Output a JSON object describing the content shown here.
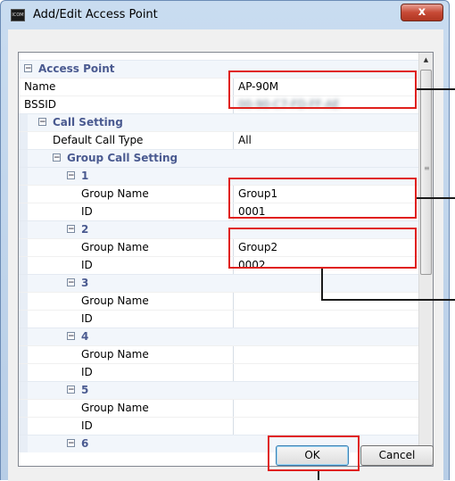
{
  "window": {
    "title": "Add/Edit Access Point",
    "icon_text": "ICOM",
    "close_glyph": "x"
  },
  "grid": {
    "access_point": {
      "label": "Access Point",
      "expander": "−"
    },
    "name": {
      "label": "Name",
      "value": "AP-90M"
    },
    "bssid": {
      "label": "BSSID",
      "value": "00-90-C7-FD-FF-AE"
    },
    "call_setting": {
      "label": "Call Setting",
      "expander": "−"
    },
    "default_call_type": {
      "label": "Default Call Type",
      "value": "All"
    },
    "group_call_setting": {
      "label": "Group Call Setting",
      "expander": "−"
    },
    "groups": [
      {
        "index": "1",
        "expander": "−",
        "name_label": "Group Name",
        "name_value": "Group1",
        "id_label": "ID",
        "id_value": "0001"
      },
      {
        "index": "2",
        "expander": "−",
        "name_label": "Group Name",
        "name_value": "Group2",
        "id_label": "ID",
        "id_value": "0002"
      },
      {
        "index": "3",
        "expander": "−",
        "name_label": "Group Name",
        "name_value": "",
        "id_label": "ID",
        "id_value": ""
      },
      {
        "index": "4",
        "expander": "−",
        "name_label": "Group Name",
        "name_value": "",
        "id_label": "ID",
        "id_value": ""
      },
      {
        "index": "5",
        "expander": "−",
        "name_label": "Group Name",
        "name_value": "",
        "id_label": "ID",
        "id_value": ""
      },
      {
        "index": "6",
        "expander": "−"
      }
    ]
  },
  "scrollbar": {
    "up_glyph": "▲",
    "down_glyph": "▼",
    "grip_glyph": "≡"
  },
  "buttons": {
    "ok": "OK",
    "cancel": "Cancel"
  },
  "colors": {
    "highlight": "#e0201c",
    "category_text": "#4a5a90",
    "close_button": "#c74a36"
  }
}
